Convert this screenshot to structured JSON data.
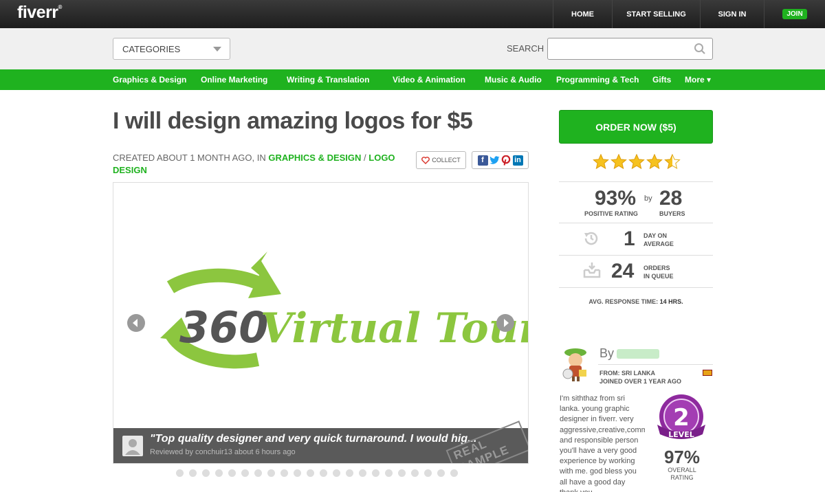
{
  "header": {
    "logo": "fiverr",
    "logo_mark": "®",
    "nav": {
      "home": "HOME",
      "start_selling": "START SELLING",
      "sign_in": "SIGN IN",
      "join": "JOIN"
    }
  },
  "search": {
    "categories_label": "CATEGORIES",
    "search_label": "SEARCH",
    "value": ""
  },
  "categories": [
    "Graphics & Design",
    "Online Marketing",
    "Writing & Translation",
    "Video & Animation",
    "Music & Audio",
    "Programming & Tech",
    "Gifts",
    "More ▾"
  ],
  "gig": {
    "title": "I will design amazing logos for $5",
    "created": "CREATED ABOUT 1 MONTH AGO, IN ",
    "category": "GRAPHICS & DESIGN",
    "separator": " / ",
    "subcategory": "LOGO DESIGN",
    "collect_label": "COLLECT"
  },
  "gallery": {
    "logo_number": "360",
    "logo_text": "Virtual Tours",
    "review_quote": "\"Top quality designer and very quick turnaround. I would hig...",
    "review_by": "Reviewed by conchuir13 about 6 hours ago",
    "stamp": "REAL SAMPLE",
    "slide_count": 22
  },
  "sidebar": {
    "order_label": "ORDER NOW ($5)",
    "rating_stars": 4.5,
    "positive_pct": "93%",
    "positive_label": "POSITIVE RATING",
    "by_word": "by",
    "buyers": "28",
    "buyers_label": "BUYERS",
    "days": "1",
    "days_label_1": "DAY ON",
    "days_label_2": "AVERAGE",
    "orders": "24",
    "orders_label_1": "ORDERS",
    "orders_label_2": "IN QUEUE",
    "response_label": "AVG. RESPONSE TIME: ",
    "response_value": "14 HRS."
  },
  "seller": {
    "by_word": "By",
    "from": "FROM: SRI LANKA",
    "joined": "JOINED OVER 1 YEAR AGO",
    "bio": "I'm siththaz from sri lanka. young graphic designer in fiverr. very aggressive,creative,communicative,talented and responsible person you'll have a very good experience by working with me. god bless you all have a good day thank you",
    "level_number": "2",
    "level_word": "LEVEL",
    "overall_pct": "97%",
    "overall_label_1": "OVERALL",
    "overall_label_2": "RATING"
  },
  "colors": {
    "brand_green": "#1fb21f",
    "logo_green": "#8cc63f",
    "logo_grey": "#555555",
    "badge_purple": "#8e2a9e"
  }
}
